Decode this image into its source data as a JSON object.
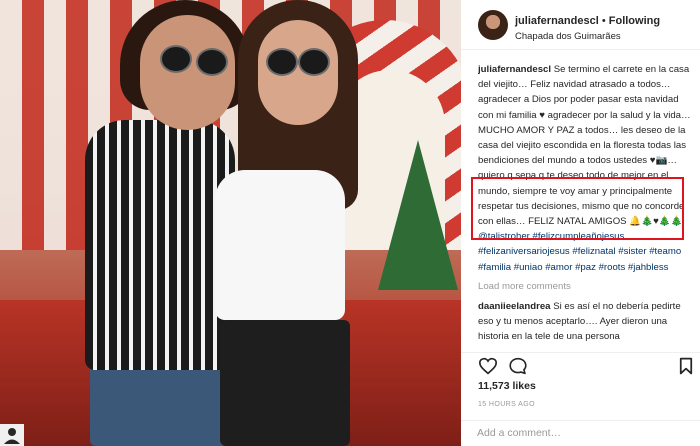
{
  "post": {
    "username": "juliafernandescl",
    "follow_separator": "•",
    "follow_status": "Following",
    "location": "Chapada dos Guimarães"
  },
  "caption": {
    "author": "juliafernandescl",
    "text_part1": "Se termino el carrete en la casa del viejito… Feliz navidad atrasado a todos… agradecer a Dios por poder pasar esta navidad con mi familia ♥ agradecer por la salud y la vida… MUCHO AMOR Y PAZ a todos… les deseo de la casa del viejito escondida en la floresta todas las bendiciones del mundo a todos ustedes ",
    "highlighted_text": "♥📷… quiero q sepa q te deseo todo de mejor en el mundo, siempre te voy amar y principalmente respetar tus decisiones, mismo que no concorde con ellas… FELIZ",
    "text_part2": " NATAL AMIGOS 🔔🎄♥🎄🎄 ",
    "mention": "@talistroher",
    "hashtags": [
      "#felizcumpleañojesus",
      "#felizaniversariojesus",
      "#feliznatal",
      "#sister",
      "#teamo",
      "#familia",
      "#uniao",
      "#amor",
      "#paz",
      "#roots",
      "#jahbless"
    ]
  },
  "load_more_label": "Load more comments",
  "comment": {
    "author": "daaniieelandrea",
    "text": "Si es así el no debería pedirte eso y tu menos aceptarlo…. Ayer dieron una historia en la tele de una persona"
  },
  "likes": "11,573 likes",
  "timestamp": "15 HOURS AGO",
  "add_comment_placeholder": "Add a comment…",
  "colors": {
    "highlight_border": "#e0141f",
    "link": "#003569",
    "muted": "#999999"
  },
  "icons": [
    "heart-icon",
    "comment-icon",
    "bookmark-icon"
  ]
}
